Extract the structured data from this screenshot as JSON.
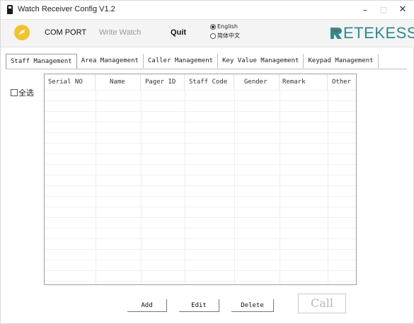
{
  "window": {
    "title": "Watch Receiver Config V1.2",
    "controls": {
      "minimize": "–",
      "maximize": "□",
      "close": "✕"
    }
  },
  "toolbar": {
    "comport_label": "COM PORT",
    "write_watch_label": "Write Watch",
    "quit_label": "Quit",
    "language": {
      "options": [
        "English",
        "简体中文"
      ],
      "selected": "English"
    },
    "brand": "ETEKESS",
    "colors": {
      "brand": "#2f8a8f",
      "logo": "#f1c232",
      "brand_mark": "#c0392b"
    }
  },
  "tabs": [
    {
      "label": "Staff Management",
      "active": true
    },
    {
      "label": "Area Management",
      "active": false
    },
    {
      "label": "Caller Management",
      "active": false
    },
    {
      "label": "Key Value Management",
      "active": false
    },
    {
      "label": "Keypad Management",
      "active": false
    }
  ],
  "select_all_label": "全选",
  "table": {
    "columns": [
      "Serial NO",
      "Name",
      "Pager ID",
      "Staff Code",
      "Gender",
      "Remark",
      "Other"
    ],
    "rows": []
  },
  "actions": {
    "add_label": "Add",
    "edit_label": "Edit",
    "delete_label": "Delete",
    "call_label": "Call"
  }
}
